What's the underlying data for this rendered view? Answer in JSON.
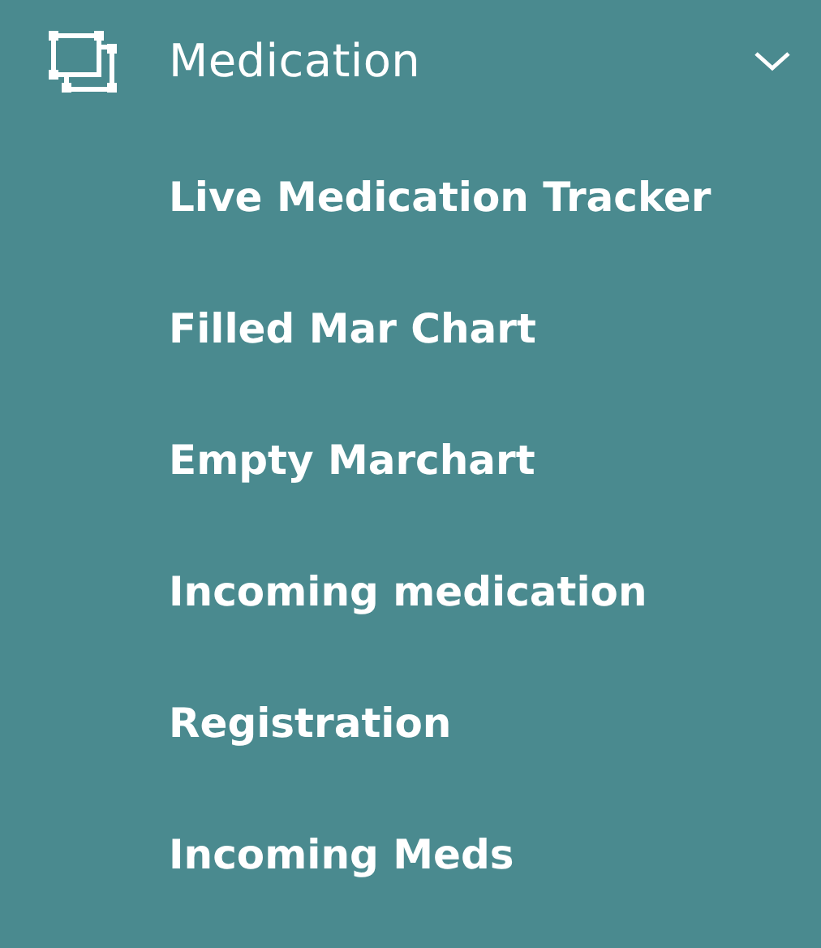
{
  "menu": {
    "label": "Medication",
    "expanded": true,
    "items": [
      {
        "label": "Live Medication Tracker"
      },
      {
        "label": "Filled Mar Chart"
      },
      {
        "label": "Empty Marchart"
      },
      {
        "label": "Incoming medication"
      },
      {
        "label": "Registration"
      },
      {
        "label": "Incoming Meds"
      }
    ]
  }
}
